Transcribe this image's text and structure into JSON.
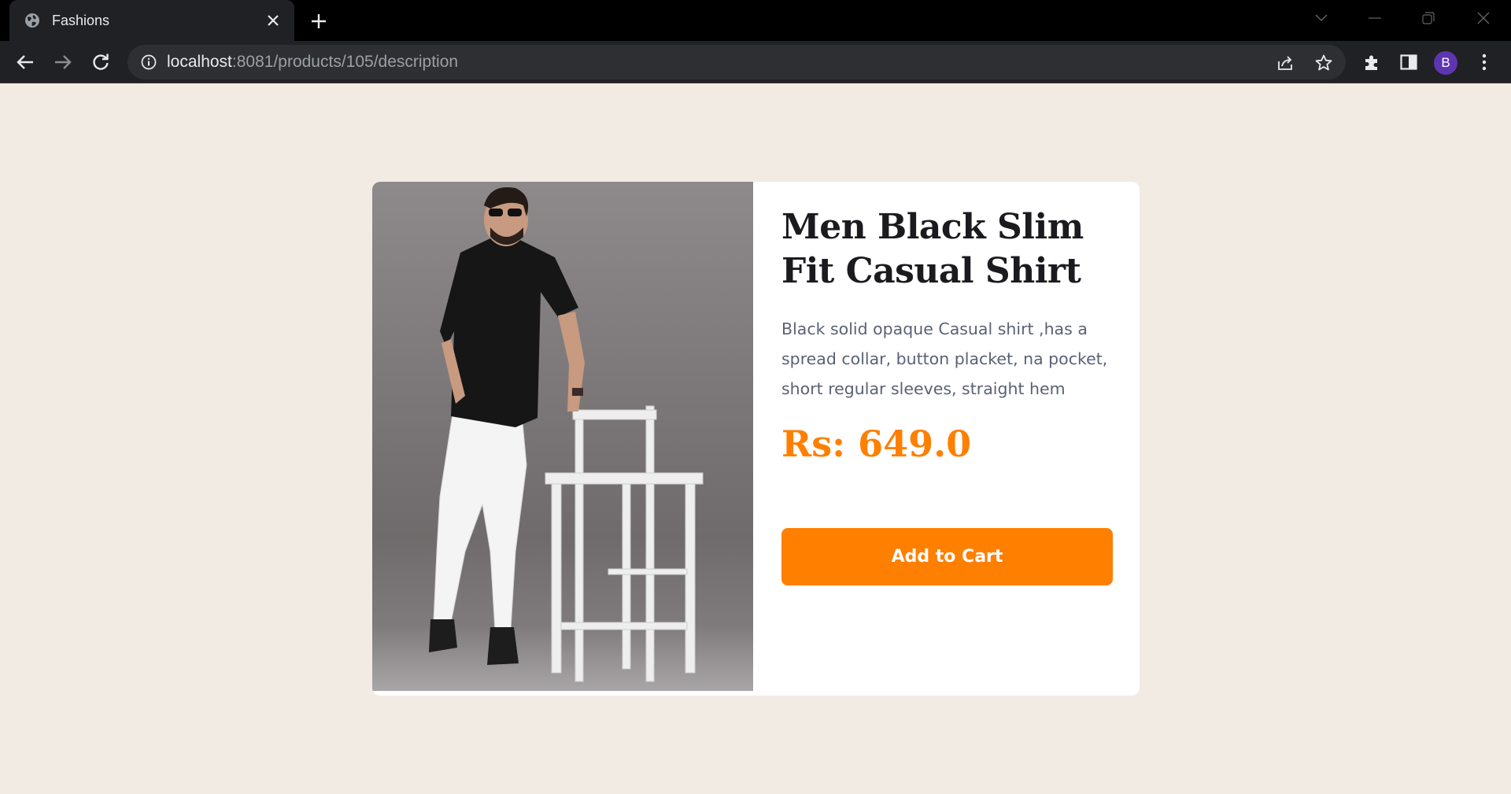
{
  "browser": {
    "tab_title": "Fashions",
    "url_host": "localhost",
    "url_rest": ":8081/products/105/description",
    "profile_initial": "B",
    "icons": [
      "globe-icon",
      "close-icon",
      "plus-icon",
      "chevron-down-icon",
      "minimize-icon",
      "restore-icon",
      "window-close-icon",
      "back-icon",
      "forward-icon",
      "reload-icon",
      "info-icon",
      "share-icon",
      "star-icon",
      "extensions-icon",
      "side-panel-icon",
      "kebab-menu-icon"
    ]
  },
  "product": {
    "title": "Men Black Slim Fit Casual Shirt",
    "description": "Black solid opaque Casual shirt ,has a spread collar, button placket, na pocket, short regular sleeves, straight hem",
    "price": "Rs: 649.0",
    "add_to_cart_label": "Add to Cart"
  },
  "colors": {
    "page_bg": "#f2ebe4",
    "accent": "#ff7f00",
    "card_bg": "#ffffff",
    "profile": "#5e35b1"
  }
}
